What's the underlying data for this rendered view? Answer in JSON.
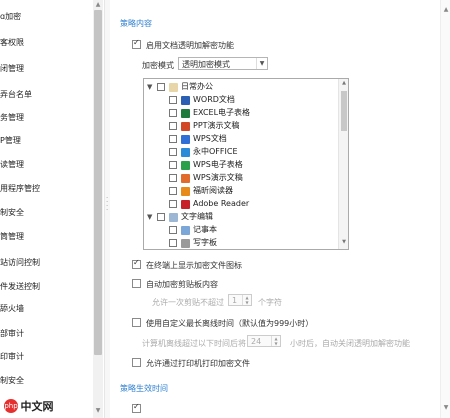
{
  "sidebar": {
    "items": [
      {
        "label": "ɑ加密"
      },
      {
        "label": "客权限"
      },
      {
        "label": "闭管理"
      },
      {
        "label": "弄台名单"
      },
      {
        "label": "务管理"
      },
      {
        "label": "P管理"
      },
      {
        "label": "读管理"
      },
      {
        "label": "用程序管控"
      },
      {
        "label": "制安全"
      },
      {
        "label": "筒管理"
      },
      {
        "label": "站访问控制"
      },
      {
        "label": "件发送控制"
      },
      {
        "label": "舔火墙"
      },
      {
        "label": "部审计"
      },
      {
        "label": "印审计"
      },
      {
        "label": "制安全"
      }
    ]
  },
  "main": {
    "section1_title": "策略内容",
    "enable_transparent": "启用文档透明加解密功能",
    "mode_label": "加密模式",
    "mode_value": "透明加密模式",
    "tree": {
      "group1": "日常办公",
      "items": [
        {
          "label": "WORD文档",
          "color": "#2b5fb4",
          "icon": "word-icon"
        },
        {
          "label": "EXCEL电子表格",
          "color": "#1f7a3e",
          "icon": "excel-icon"
        },
        {
          "label": "PPT演示文稿",
          "color": "#d24726",
          "icon": "ppt-icon"
        },
        {
          "label": "WPS文档",
          "color": "#2f6fd6",
          "icon": "wps-doc-icon"
        },
        {
          "label": "永中OFFICE",
          "color": "#2a8bd8",
          "icon": "yozo-icon"
        },
        {
          "label": "WPS电子表格",
          "color": "#2aa04a",
          "icon": "wps-sheet-icon"
        },
        {
          "label": "WPS演示文稿",
          "color": "#e06b2a",
          "icon": "wps-slide-icon"
        },
        {
          "label": "福昕阅读器",
          "color": "#e88a1a",
          "icon": "foxit-icon"
        },
        {
          "label": "Adobe Reader",
          "color": "#c8202a",
          "icon": "adobe-icon"
        }
      ],
      "group2": "文字编辑",
      "items2": [
        {
          "label": "记事本",
          "color": "#7aa7d8",
          "icon": "notepad-icon"
        },
        {
          "label": "写字板",
          "color": "#9a9a9a",
          "icon": "wordpad-icon"
        }
      ]
    },
    "show_icon": "在终端上显示加密文件图标",
    "auto_encrypt_clip": "自动加密剪贴板内容",
    "clip_limit_prefix": "允许一次剪贴不超过",
    "clip_limit_value": "1",
    "clip_limit_suffix": "个字符",
    "offline_time": "使用自定义最长离线时间（默认值为999小时）",
    "offline_prefix": "计算机离线超过以下时间后将自动",
    "offline_value": "24",
    "offline_suffix": "小时后，自动关闭透明加解密功能",
    "allow_print": "允许通过打印机打印加密文件",
    "section2_title": "策略生效时间"
  },
  "watermark": {
    "logo_text": "php",
    "text": "中文网"
  }
}
